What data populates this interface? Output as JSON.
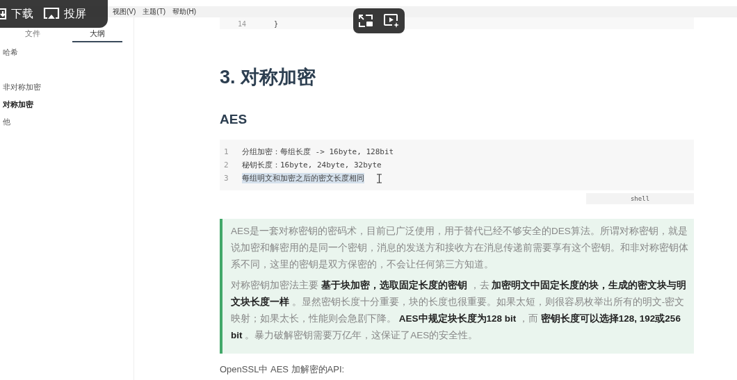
{
  "menu_bar": {
    "items": [
      "视图(V)",
      "主题(T)",
      "帮助(H)"
    ]
  },
  "sidebar": {
    "tabs": [
      {
        "label": "文件",
        "selected": false
      },
      {
        "label": "大纲",
        "selected": true
      }
    ],
    "items": [
      {
        "label": "哈希",
        "selected": false
      },
      {
        "label": "非对称加密",
        "selected": false
      },
      {
        "label": "对称加密",
        "selected": true
      },
      {
        "label": "他",
        "selected": false
      }
    ]
  },
  "document": {
    "top_code": {
      "lines": [
        {
          "number": "14",
          "text": "}"
        }
      ]
    },
    "heading": "3. 对称加密",
    "subheading": "AES",
    "code_block": {
      "lines": [
        {
          "number": "1",
          "text": "分组加密：每组长度 -> 16byte, 128bit",
          "selected": false
        },
        {
          "number": "2",
          "text": "秘钥长度：16byte, 24byte, 32byte",
          "selected": false
        },
        {
          "number": "3",
          "text": "每组明文和加密之后的密文长度相同",
          "selected": true
        }
      ],
      "language": "shell"
    },
    "blockquote": [
      "AES是一套对称密钥的密码术，目前已广泛使用，用于替代已经不够安全的DES算法。所谓对称密钥，就是说加密和解密用的是同一个密钥，消息的发送方和接收方在消息传递前需要享有这个密钥。和非对称密钥体系不同，这里的密钥是双方保密的，不会让任何第三方知道。",
      "对称密钥加密法主要 **基于块加密，选取固定长度的密钥** ，去 **加密明文中固定长度的块，生成的密文块与明文块长度一样** 。显然密钥长度十分重要，块的长度也很重要。如果太短，则很容易枚举出所有的明文-密文映射；如果太长，性能则会急剧下降。 **AES中规定块长度为128 bit** ，而 **密钥长度可以选择128, 192或256 bit** 。暴力破解密钥需要万亿年，这保证了AES的安全性。"
    ],
    "paragraph": "OpenSSL中 AES 加解密的API:"
  },
  "player_overlay": {
    "buttons": [
      {
        "kind": "download",
        "label": "下载"
      },
      {
        "kind": "cast",
        "label": "投屏"
      }
    ],
    "icons": [
      {
        "kind": "pip"
      },
      {
        "kind": "ai-video"
      }
    ]
  }
}
